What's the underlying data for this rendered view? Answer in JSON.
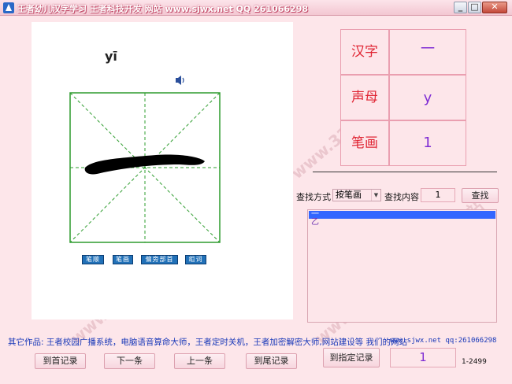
{
  "window": {
    "title": "王者幼儿汉字学习  王者科技开发   网站 www.sjwx.net QQ 261066298",
    "min_glyph": "_",
    "max_glyph": "□",
    "close_glyph": "✕"
  },
  "character_panel": {
    "pinyin": "yī",
    "stroke_buttons": [
      "笔顺",
      "笔画",
      "偏旁部首",
      "组词"
    ]
  },
  "info_table": {
    "hanzi_label": "汉字",
    "hanzi_value": "一",
    "shengmu_label": "声母",
    "shengmu_value": "y",
    "bihua_label": "笔画",
    "bihua_value": "1"
  },
  "search": {
    "method_label": "查找方式",
    "method_value": "按笔画",
    "content_label": "查找内容",
    "content_value": "1",
    "search_button": "查找"
  },
  "results": {
    "items": [
      "一",
      "乙"
    ],
    "selected_index": 0
  },
  "footer": {
    "other_works": "其它作品: 王者校园广播系统，电脑语音算命大师，王者定时关机，王者加密解密大师,网站建设等 我们的网站",
    "website": "www.sjwx.net qq:261066298",
    "first_record": "到首记录",
    "next_record": "下一条",
    "prev_record": "上一条",
    "last_record": "到尾记录",
    "goto_record": "到指定记录",
    "record_number": "1",
    "record_range": "1-2499"
  },
  "watermark_text": "www.3322.cc 3322下载站",
  "colors": {
    "background": "#fde6ea",
    "label_red": "#e02634",
    "value_purple": "#7f2dd4",
    "grid_green": "#2e9c2e",
    "link_blue": "#1737b8",
    "selection_blue": "#3366ff"
  },
  "icons": [
    "app-icon",
    "speaker-icon",
    "dropdown-arrow-icon"
  ]
}
